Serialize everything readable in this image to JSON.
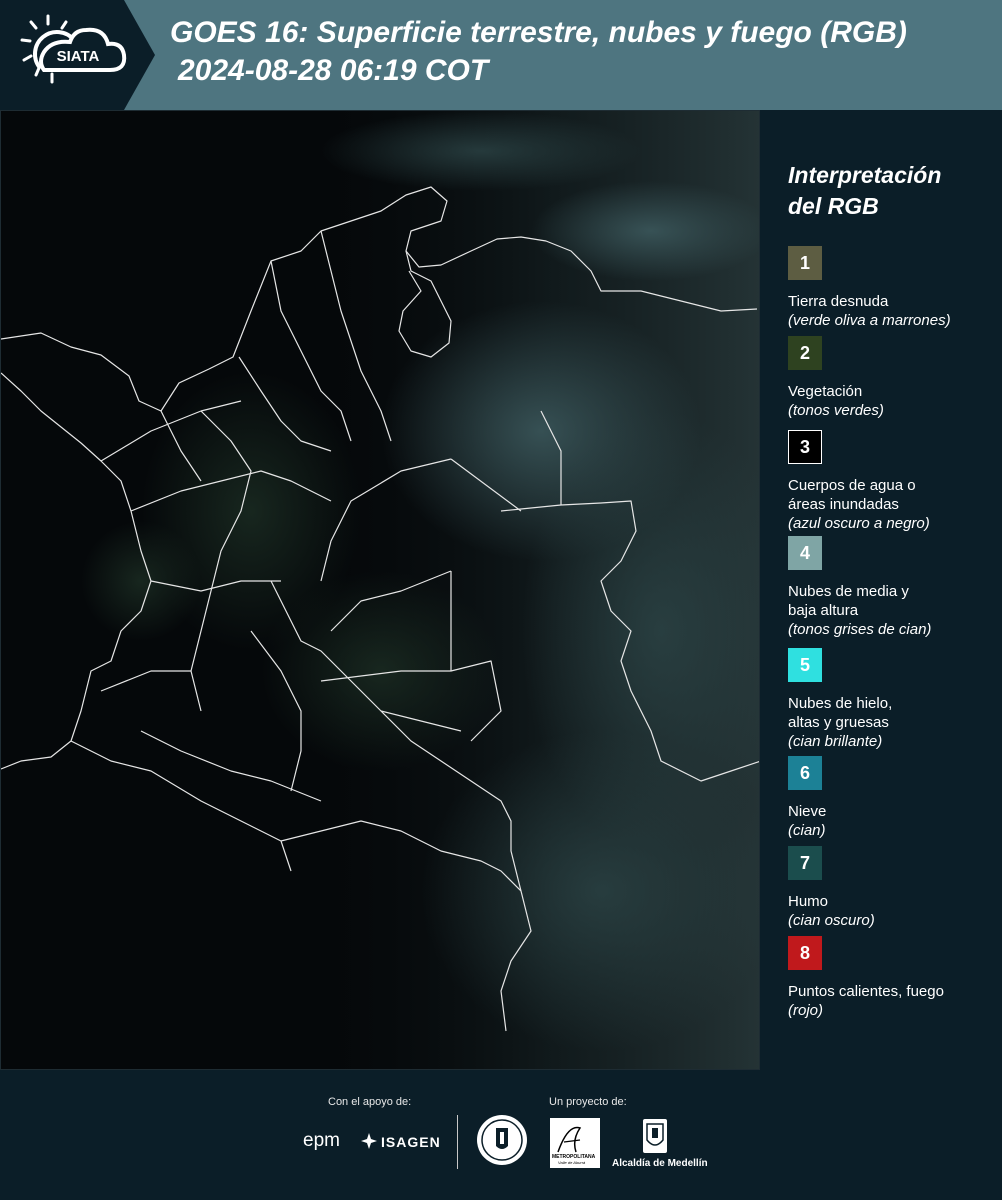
{
  "header": {
    "logo_text": "SIATA",
    "title_line1": "GOES 16: Superficie terrestre, nubes y fuego (RGB)",
    "title_line2": "2024-08-28 06:19 COT"
  },
  "legend": {
    "title_line1": "Interpretación",
    "title_line2": "del RGB",
    "items": [
      {
        "number": "1",
        "color": "#5d5d42",
        "label": "Tierra desnuda",
        "desc": "(verde oliva a marrones)"
      },
      {
        "number": "2",
        "color": "#2e4220",
        "label": "Vegetación",
        "desc": "(tonos verdes)"
      },
      {
        "number": "3",
        "color": "#000000",
        "label": "Cuerpos de agua o áreas inundadas",
        "desc": "(azul oscuro a negro)"
      },
      {
        "number": "4",
        "color": "#7fa5a5",
        "label": "Nubes de media y baja altura",
        "desc": "(tonos grises de cian)"
      },
      {
        "number": "5",
        "color": "#2fe0e0",
        "label": "Nubes de hielo, altas y gruesas",
        "desc": "(cian brillante)"
      },
      {
        "number": "6",
        "color": "#1c8196",
        "label": "Nieve",
        "desc": "(cian)"
      },
      {
        "number": "7",
        "color": "#1b4d4d",
        "label": "Humo",
        "desc": "(cian oscuro)"
      },
      {
        "number": "8",
        "color": "#c0191c",
        "label": "Puntos calientes, fuego",
        "desc": "(rojo)"
      }
    ]
  },
  "footer": {
    "support_caption": "Con el apoyo de:",
    "project_caption": "Un proyecto de:",
    "epm": "epm",
    "isagen": "ISAGEN",
    "area_metro": "METROPOLITANA",
    "area_valle": "Valle de Aburrá",
    "alcaldia": "Alcaldía de Medellín"
  },
  "colors": {
    "header_bg": "#4e7580",
    "logo_bg": "#0b1e28",
    "page_bg": "#0b1e28",
    "map_bg": "#05080a",
    "border_lines": "#e6e6e6"
  }
}
